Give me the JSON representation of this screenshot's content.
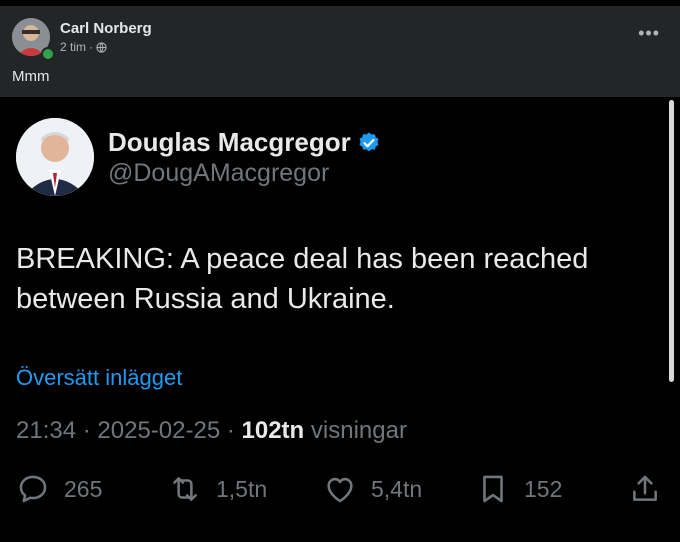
{
  "facebook_post": {
    "author": "Carl Norberg",
    "time": "2 tim",
    "separator": "·",
    "caption": "Mmm",
    "more_label": "•••"
  },
  "tweet": {
    "display_name": "Douglas Macgregor",
    "handle": "@DougAMacgregor",
    "text": "BREAKING: A peace deal has been reached between Russia and Ukraine.",
    "translate_label": "Översätt inlägget",
    "time": "21:34",
    "date": "2025-02-25",
    "views_count": "102tn",
    "views_label": "visningar",
    "sep": "·",
    "actions": {
      "replies": "265",
      "reposts": "1,5tn",
      "likes": "5,4tn",
      "bookmarks": "152"
    }
  },
  "colors": {
    "accent": "#1d9bf0",
    "muted": "#71767b",
    "fb_bg": "#242526",
    "online": "#31a24c"
  },
  "icons": [
    "globe-icon",
    "verified-badge-icon",
    "reply-icon",
    "repost-icon",
    "like-icon",
    "bookmark-icon",
    "share-icon",
    "more-icon"
  ]
}
